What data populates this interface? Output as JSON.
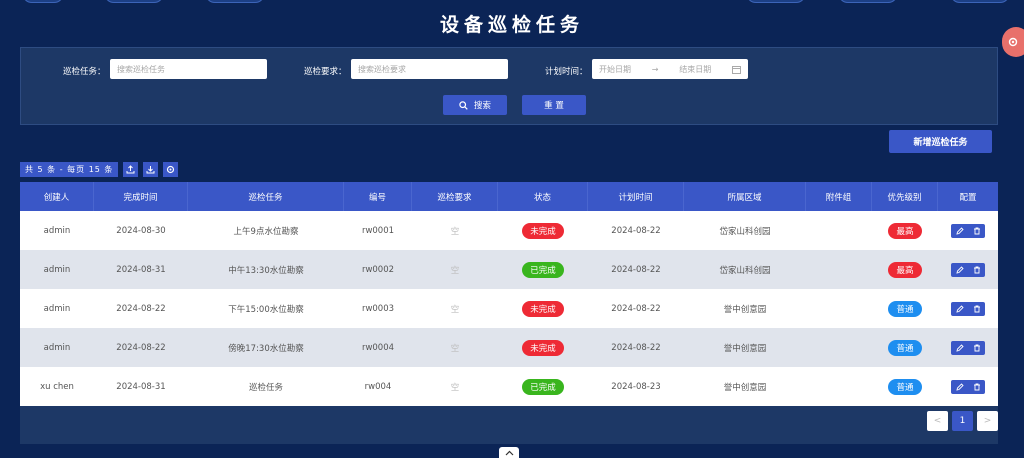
{
  "header": {
    "title": "设备巡检任务"
  },
  "search": {
    "task_label": "巡检任务：",
    "task_placeholder": "搜索巡检任务",
    "req_label": "巡检要求：",
    "req_placeholder": "搜索巡检要求",
    "plan_label": "计划时间：",
    "start_placeholder": "开始日期",
    "range_sep": "→",
    "end_placeholder": "结束日期",
    "search_button": "搜索",
    "reset_button": "重 置"
  },
  "toolbar": {
    "add_button": "新增巡检任务",
    "count_text": "共 5 条 - 每页 15 条"
  },
  "table": {
    "columns": [
      "创建人",
      "完成时间",
      "巡检任务",
      "编号",
      "巡检要求",
      "状态",
      "计划时间",
      "所属区域",
      "附件组",
      "优先级别",
      "配置"
    ],
    "rows": [
      {
        "creator": "admin",
        "finish": "2024-08-30",
        "task": "上午9点水位勘察",
        "code": "rw0001",
        "req": "空",
        "status": "未完成",
        "plan": "2024-08-22",
        "area": "岱家山科创园",
        "attach": "",
        "priority": "最高"
      },
      {
        "creator": "admin",
        "finish": "2024-08-31",
        "task": "中午13:30水位勘察",
        "code": "rw0002",
        "req": "空",
        "status": "已完成",
        "plan": "2024-08-22",
        "area": "岱家山科创园",
        "attach": "",
        "priority": "最高"
      },
      {
        "creator": "admin",
        "finish": "2024-08-22",
        "task": "下午15:00水位勘察",
        "code": "rw0003",
        "req": "空",
        "status": "未完成",
        "plan": "2024-08-22",
        "area": "誉中创意园",
        "attach": "",
        "priority": "普通"
      },
      {
        "creator": "admin",
        "finish": "2024-08-22",
        "task": "傍晚17:30水位勘察",
        "code": "rw0004",
        "req": "空",
        "status": "未完成",
        "plan": "2024-08-22",
        "area": "誉中创意园",
        "attach": "",
        "priority": "普通"
      },
      {
        "creator": "xu chen",
        "finish": "2024-08-31",
        "task": "巡检任务",
        "code": "rw004",
        "req": "空",
        "status": "已完成",
        "plan": "2024-08-23",
        "area": "誉中创意园",
        "attach": "",
        "priority": "普通"
      }
    ]
  },
  "pagination": {
    "prev": "<",
    "current": "1",
    "next": ">"
  },
  "colors": {
    "bg": "#0b2456",
    "panel": "#1d3866",
    "accent": "#3a57c7",
    "danger": "#ee2a35",
    "success": "#39b51e",
    "info": "#1e8ef0"
  },
  "icons": [
    "search-icon",
    "calendar-icon",
    "upload-icon",
    "download-icon",
    "gear-icon",
    "edit-icon",
    "delete-icon",
    "chevron-up-icon",
    "settings-float-icon"
  ]
}
